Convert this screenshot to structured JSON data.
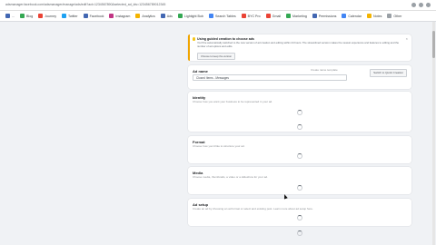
{
  "browser": {
    "url": "adsmanager.facebook.com/adsmanager/manage/ads/edit?act=1234567890&selected_ad_ids=123456789012345"
  },
  "bookmarks": [
    {
      "label": "...",
      "color": "#4267b2"
    },
    {
      "label": "Blog",
      "color": "#34a853"
    },
    {
      "label": "Journey",
      "color": "#ea4335"
    },
    {
      "label": "Twitter",
      "color": "#1da1f2"
    },
    {
      "label": "Facebook",
      "color": "#4267b2"
    },
    {
      "label": "Instagram",
      "color": "#c13584"
    },
    {
      "label": "Analytics",
      "color": "#f4b400"
    },
    {
      "label": "Ads",
      "color": "#4267b2"
    },
    {
      "label": "Lightight Bob",
      "color": "#34a853"
    },
    {
      "label": "Search Tables",
      "color": "#4285f4"
    },
    {
      "label": "BYC Pro",
      "color": "#ea4335"
    },
    {
      "label": "Gmail",
      "color": "#ea4335"
    },
    {
      "label": "Marketing",
      "color": "#34a853"
    },
    {
      "label": "Permissions",
      "color": "#4267b2"
    },
    {
      "label": "Calendar",
      "color": "#4285f4"
    },
    {
      "label": "Notes",
      "color": "#f4b400"
    },
    {
      "label": "Other",
      "color": "#9aa0a6"
    }
  ],
  "info_card": {
    "title": "Using guided creation to choose ads",
    "text": "You'll be automatically switched to the new version of ad creation and editing within 24 hours. The streamlined version makes the newest experience and features to editing and the number of ad options and edits.",
    "button": "Choose to keep the version",
    "close": "×"
  },
  "ad_name_card": {
    "title": "Ad name",
    "input_value": "Closed Items - Messages",
    "create_template": "Create name template",
    "switch_button": "Switch to Quick Creation"
  },
  "sections": [
    {
      "title": "Identity",
      "desc": "Choose how you want your business to be represented in your ad."
    },
    {
      "title": "Format",
      "desc": "Choose how you'd like to structure your ad."
    },
    {
      "title": "Media",
      "desc": "Choose media, thumbnails, a video or a slideshow for your ad."
    },
    {
      "title": "Ad setup",
      "desc": "Create an ad by choosing an ad format or select and existing post. Learn more about ad setup here."
    }
  ],
  "colors": {
    "accent": "#f0a500",
    "card_bg": "#ffffff",
    "page_bg": "#f0f2f5"
  }
}
